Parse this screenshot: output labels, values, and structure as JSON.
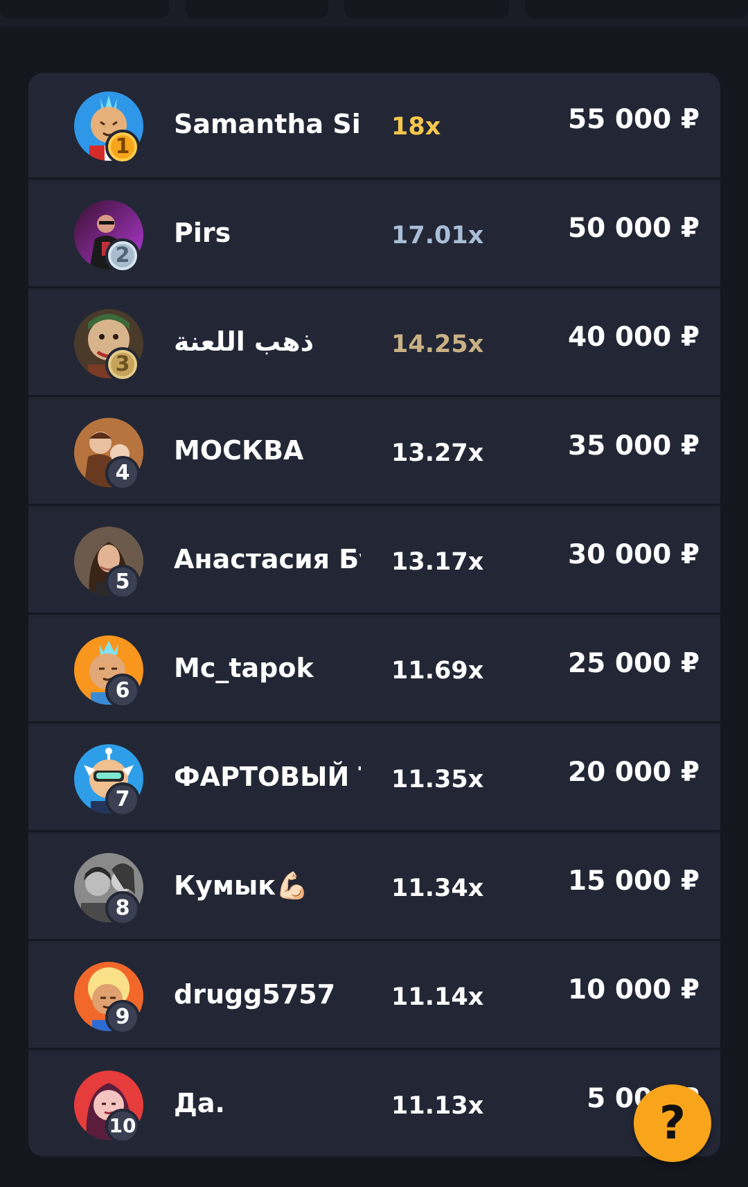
{
  "colors": {
    "background": "#15171f",
    "panel": "#202430",
    "gold_multiplier": "#f5c84d",
    "silver_multiplier": "#a9bdd6",
    "bronze_multiplier": "#c9b185",
    "help_button": "#f8a51c"
  },
  "leaderboard": {
    "rows": [
      {
        "rank": "1",
        "name": "Samantha Si...",
        "multiplier": "18x",
        "prize": "55 000 ₽"
      },
      {
        "rank": "2",
        "name": "Pirs",
        "multiplier": "17.01x",
        "prize": "50 000 ₽"
      },
      {
        "rank": "3",
        "name": "ذهب اللعنة",
        "multiplier": "14.25x",
        "prize": "40 000 ₽"
      },
      {
        "rank": "4",
        "name": "МОСКВА",
        "multiplier": "13.27x",
        "prize": "35 000 ₽"
      },
      {
        "rank": "5",
        "name": "Анастасия Бу...",
        "multiplier": "13.17x",
        "prize": "30 000 ₽"
      },
      {
        "rank": "6",
        "name": "Mc_tapok",
        "multiplier": "11.69x",
        "prize": "25 000 ₽"
      },
      {
        "rank": "7",
        "name": "ФАРТОВЫЙ Т...",
        "multiplier": "11.35x",
        "prize": "20 000 ₽"
      },
      {
        "rank": "8",
        "name": "Кумык💪🏻",
        "multiplier": "11.34x",
        "prize": "15 000 ₽"
      },
      {
        "rank": "9",
        "name": "drugg5757",
        "multiplier": "11.14x",
        "prize": "10 000 ₽"
      },
      {
        "rank": "10",
        "name": "Да.",
        "multiplier": "11.13x",
        "prize": "5 000 ₽"
      }
    ]
  },
  "help_button": {
    "label": "?"
  }
}
